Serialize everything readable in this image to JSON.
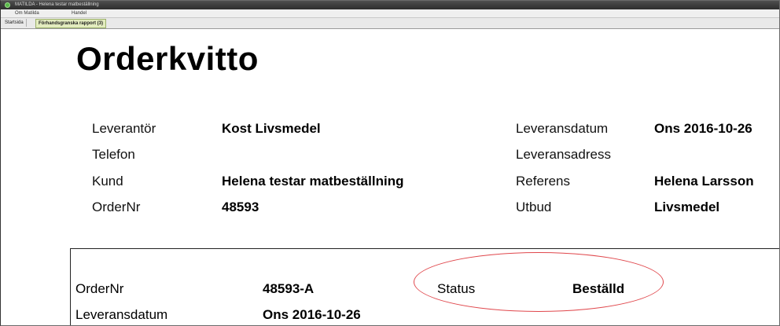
{
  "window": {
    "title": "MATILDA - Helena testar matbeställning"
  },
  "menubar": {
    "items": [
      "Om Matilda",
      "Handel"
    ]
  },
  "tabs": [
    {
      "label": "Startsida",
      "active": false
    },
    {
      "label": "Förhandsgranska rapport (3)",
      "active": true
    }
  ],
  "report": {
    "heading": "Orderkvitto",
    "left_fields": [
      {
        "label": "Leverantör",
        "value": "Kost Livsmedel"
      },
      {
        "label": "Telefon",
        "value": ""
      },
      {
        "label": "Kund",
        "value": "Helena testar matbeställning"
      },
      {
        "label": "OrderNr",
        "value": "48593"
      }
    ],
    "right_fields": [
      {
        "label": "Leveransdatum",
        "value": "Ons 2016-10-26"
      },
      {
        "label": "Leveransadress",
        "value": ""
      },
      {
        "label": "Referens",
        "value": "Helena Larsson"
      },
      {
        "label": "Utbud",
        "value": "Livsmedel"
      }
    ],
    "order_table": {
      "ordernr_label": "OrderNr",
      "ordernr_value": "48593-A",
      "status_label": "Status",
      "status_value": "Beställd",
      "date_label": "Leveransdatum",
      "date_value": "Ons 2016-10-26"
    }
  },
  "colors": {
    "highlight": "#e0474c",
    "active_tab": "#e3ecbf",
    "titlebar": "#3a3a3a"
  }
}
